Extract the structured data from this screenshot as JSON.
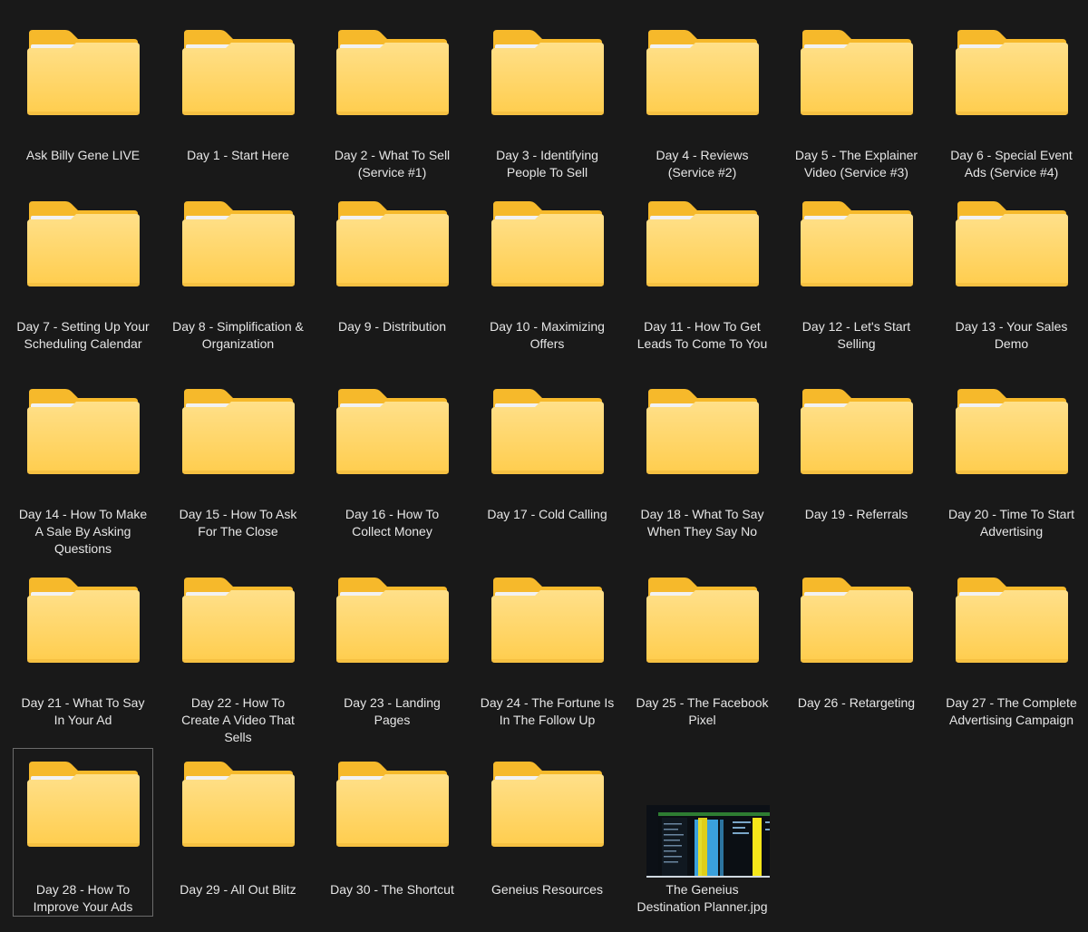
{
  "items": [
    {
      "type": "folder",
      "name": "Ask Billy Gene LIVE"
    },
    {
      "type": "folder",
      "name": "Day 1 - Start Here"
    },
    {
      "type": "folder",
      "name": "Day 2 - What To Sell (Service #1)"
    },
    {
      "type": "folder",
      "name": "Day 3 - Identifying People To Sell"
    },
    {
      "type": "folder",
      "name": "Day 4 - Reviews (Service #2)"
    },
    {
      "type": "folder",
      "name": "Day 5 - The Explainer Video (Service #3)"
    },
    {
      "type": "folder",
      "name": "Day 6 - Special Event Ads (Service #4)"
    },
    {
      "type": "folder",
      "name": "Day 7 - Setting Up Your Scheduling Calendar"
    },
    {
      "type": "folder",
      "name": "Day 8 - Simplification & Organization"
    },
    {
      "type": "folder",
      "name": "Day 9 - Distribution"
    },
    {
      "type": "folder",
      "name": "Day 10 - Maximizing Offers"
    },
    {
      "type": "folder",
      "name": "Day 11 - How To Get Leads To Come To You"
    },
    {
      "type": "folder",
      "name": "Day 12 - Let's Start Selling"
    },
    {
      "type": "folder",
      "name": "Day 13 - Your Sales Demo"
    },
    {
      "type": "folder",
      "name": "Day 14 - How To Make A Sale By Asking Questions"
    },
    {
      "type": "folder",
      "name": "Day 15 - How To Ask For The Close"
    },
    {
      "type": "folder",
      "name": "Day 16 - How To Collect Money"
    },
    {
      "type": "folder",
      "name": "Day 17 - Cold Calling"
    },
    {
      "type": "folder",
      "name": "Day 18 - What To Say When They Say No"
    },
    {
      "type": "folder",
      "name": "Day 19 - Referrals"
    },
    {
      "type": "folder",
      "name": "Day 20 - Time To Start Advertising"
    },
    {
      "type": "folder",
      "name": "Day 21 - What To Say In Your Ad"
    },
    {
      "type": "folder",
      "name": "Day 22 - How To Create A Video That Sells"
    },
    {
      "type": "folder",
      "name": "Day 23 - Landing Pages"
    },
    {
      "type": "folder",
      "name": "Day 24 - The Fortune Is In The Follow Up"
    },
    {
      "type": "folder",
      "name": "Day 25 - The Facebook Pixel"
    },
    {
      "type": "folder",
      "name": "Day 26 - Retargeting"
    },
    {
      "type": "folder",
      "name": "Day 27 - The Complete Advertising Campaign"
    },
    {
      "type": "folder",
      "name": "Day 28 - How To Improve Your Ads",
      "selected": true
    },
    {
      "type": "folder",
      "name": "Day 29 - All Out Blitz"
    },
    {
      "type": "folder",
      "name": "Day 30 - The Shortcut"
    },
    {
      "type": "folder",
      "name": "Geneius Resources"
    },
    {
      "type": "image",
      "name": "The Geneius Destination Planner.jpg"
    }
  ],
  "colors": {
    "background": "#191919",
    "folder_front": "#ffd766",
    "folder_back": "#f6b92b",
    "label_text": "#e6e6e6",
    "selection_border": "#6b6b6b"
  }
}
